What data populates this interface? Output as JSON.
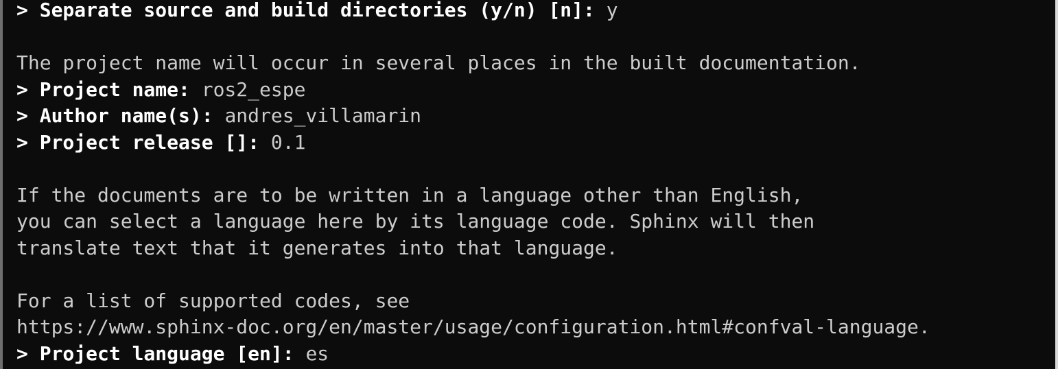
{
  "terminal": {
    "lines": [
      {
        "type": "input",
        "prompt": "> Separate source and build directories (y/n) [n]: ",
        "value": "y"
      },
      {
        "type": "blank"
      },
      {
        "type": "text",
        "text": "The project name will occur in several places in the built documentation."
      },
      {
        "type": "input",
        "prompt": "> Project name: ",
        "value": "ros2_espe"
      },
      {
        "type": "input",
        "prompt": "> Author name(s): ",
        "value": "andres_villamarin"
      },
      {
        "type": "input",
        "prompt": "> Project release []: ",
        "value": "0.1"
      },
      {
        "type": "blank"
      },
      {
        "type": "text",
        "text": "If the documents are to be written in a language other than English,"
      },
      {
        "type": "text",
        "text": "you can select a language here by its language code. Sphinx will then"
      },
      {
        "type": "text",
        "text": "translate text that it generates into that language."
      },
      {
        "type": "blank"
      },
      {
        "type": "text",
        "text": "For a list of supported codes, see"
      },
      {
        "type": "text",
        "text": "https://www.sphinx-doc.org/en/master/usage/configuration.html#confval-language."
      },
      {
        "type": "input",
        "prompt": "> Project language [en]: ",
        "value": "es"
      }
    ]
  },
  "colors": {
    "background": "#0c0c0c",
    "text": "#cccccc",
    "prompt": "#ffffff"
  }
}
